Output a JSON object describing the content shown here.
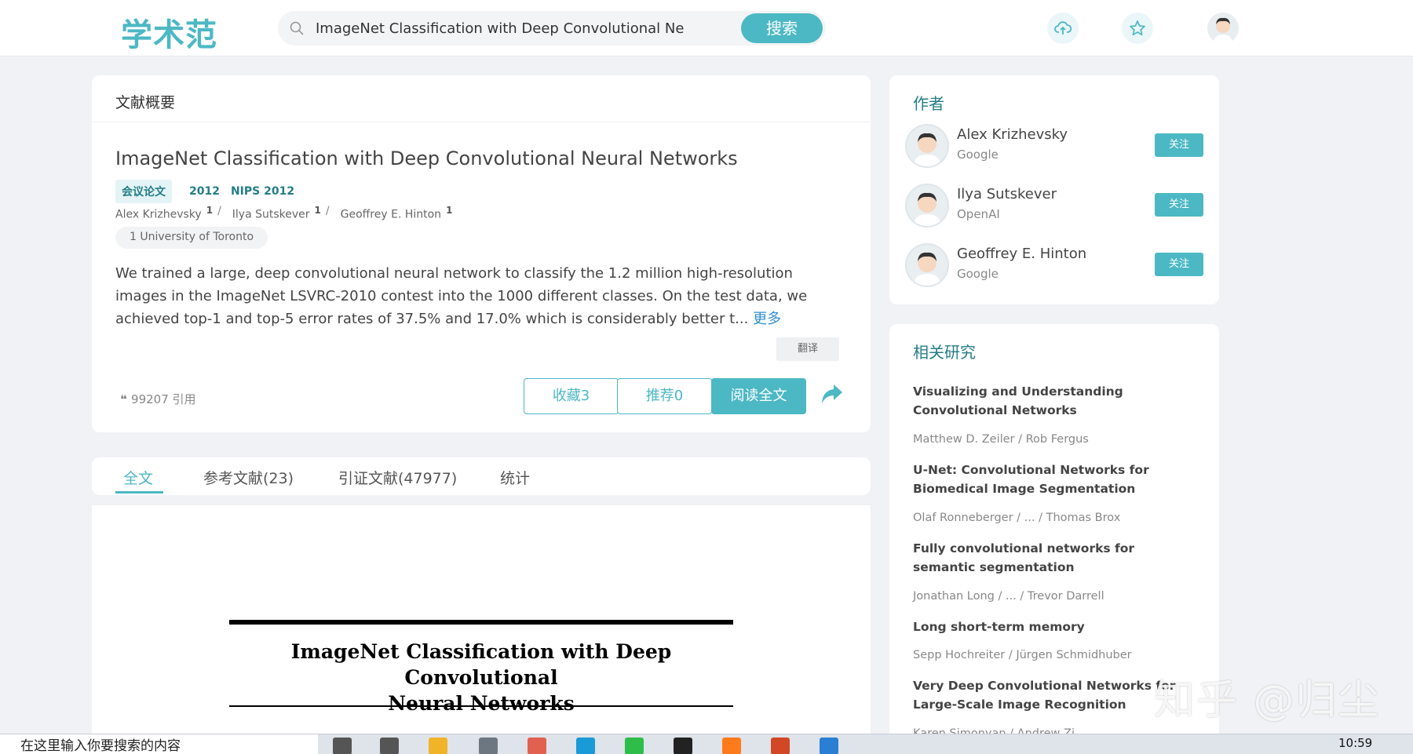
{
  "header": {
    "logo": "学术范",
    "search_value": "ImageNet Classification with Deep Convolutional Neural Networks",
    "search_button": "搜索",
    "icons": [
      "upload-cloud-icon",
      "star-icon",
      "avatar"
    ]
  },
  "summary": {
    "heading": "文献概要",
    "title": "ImageNet Classification with Deep Convolutional Neural Networks",
    "type": "会议论文",
    "year": "2012",
    "venue": "NIPS 2012",
    "authors": [
      {
        "name": "Alex Krizhevsky",
        "sup": "1"
      },
      {
        "name": "Ilya Sutskever",
        "sup": "1"
      },
      {
        "name": "Geoffrey E. Hinton",
        "sup": "1"
      }
    ],
    "author_sep": "/",
    "affiliation": "1   University of Toronto",
    "abstract": "We trained a large, deep convolutional neural network to classify the 1.2 million high-resolution images in the ImageNet LSVRC-2010 contest into the 1000 different classes. On the test data, we achieved top-1 and top-5 error rates of 37.5% and 17.0% which is considerably better t...",
    "more": "更多",
    "translate": "翻译",
    "citations": "99207 引用",
    "collect": "收藏3",
    "recommend": "推荐0",
    "read": "阅读全文"
  },
  "tabs": [
    "全文",
    "参考文献(23)",
    "引证文献(47977)",
    "统计"
  ],
  "document": {
    "title_line1": "ImageNet Classification with Deep Convolutional",
    "title_line2": "Neural Networks"
  },
  "authors_panel": {
    "title": "作者",
    "follow": "关注",
    "items": [
      {
        "name": "Alex Krizhevsky",
        "org": "Google"
      },
      {
        "name": "Ilya Sutskever",
        "org": "OpenAI"
      },
      {
        "name": "Geoffrey E. Hinton",
        "org": "Google"
      }
    ]
  },
  "related": {
    "title": "相关研究",
    "items": [
      {
        "title": "Visualizing and Understanding Convolutional Networks",
        "authors": "Matthew D. Zeiler   / Rob Fergus"
      },
      {
        "title": "U-Net: Convolutional Networks for Biomedical Image Segmentation",
        "authors": "Olaf Ronneberger   /   ...   /   Thomas Brox"
      },
      {
        "title": "Fully convolutional networks for semantic segmentation",
        "authors": "Jonathan Long   /   ...   /   Trevor Darrell"
      },
      {
        "title": "Long short-term memory",
        "authors": "Sepp Hochreiter   / Jürgen Schmidhuber"
      },
      {
        "title": "Very Deep Convolutional Networks for Large-Scale Image Recognition",
        "authors": "Karen Simonyan   / Andrew Zi..."
      }
    ]
  },
  "watermark": "知乎 @归尘",
  "taskbar": {
    "search_placeholder": "在这里输入你要搜索的内容",
    "time": "10:59"
  }
}
